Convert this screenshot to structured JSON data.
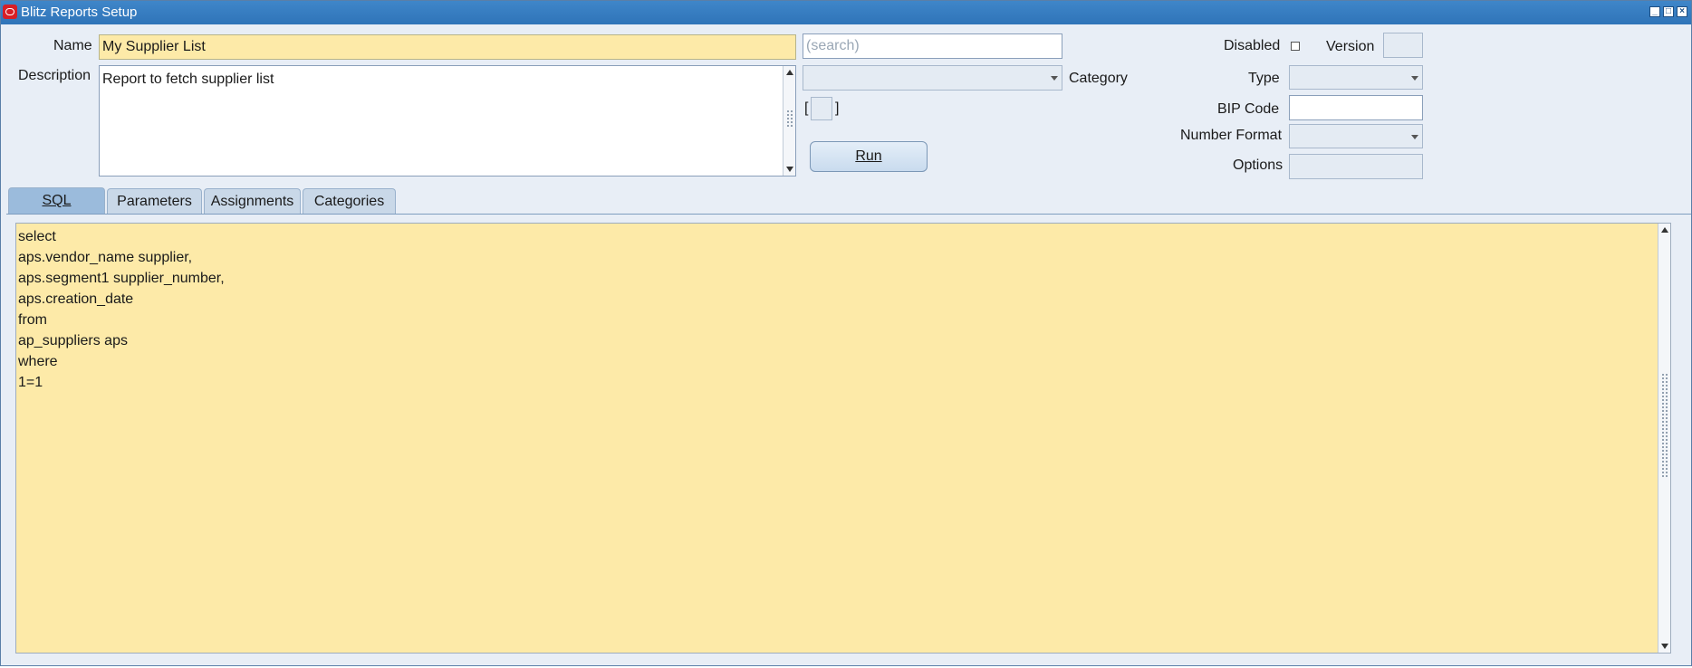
{
  "window": {
    "title": "Blitz Reports Setup"
  },
  "form": {
    "name_label": "Name",
    "name_value": "My Supplier List",
    "search_placeholder": "(search)",
    "description_label": "Description",
    "description_value": "Report to fetch supplier list",
    "category_label": "Category",
    "category_value": "",
    "bracket_open": "[",
    "bracket_close": "]",
    "run_label": "Run",
    "disabled_label": "Disabled",
    "version_label": "Version",
    "version_value": "",
    "type_label": "Type",
    "type_value": "",
    "bip_code_label": "BIP Code",
    "bip_code_value": "",
    "number_format_label": "Number Format",
    "number_format_value": "",
    "options_label": "Options",
    "options_value": ""
  },
  "tabs": [
    {
      "label": "SQL",
      "active": true
    },
    {
      "label": "Parameters",
      "active": false
    },
    {
      "label": "Assignments",
      "active": false
    },
    {
      "label": "Categories",
      "active": false
    }
  ],
  "sql": {
    "lines": [
      "select",
      "aps.vendor_name supplier,",
      "aps.segment1 supplier_number,",
      "aps.creation_date",
      "from",
      "ap_suppliers aps",
      "where",
      "1=1"
    ]
  },
  "colors": {
    "titlebar": "#2f74b8",
    "field_highlight": "#fdeaa8",
    "window_bg": "#e8eef6",
    "active_tab": "#9bbbdc"
  }
}
